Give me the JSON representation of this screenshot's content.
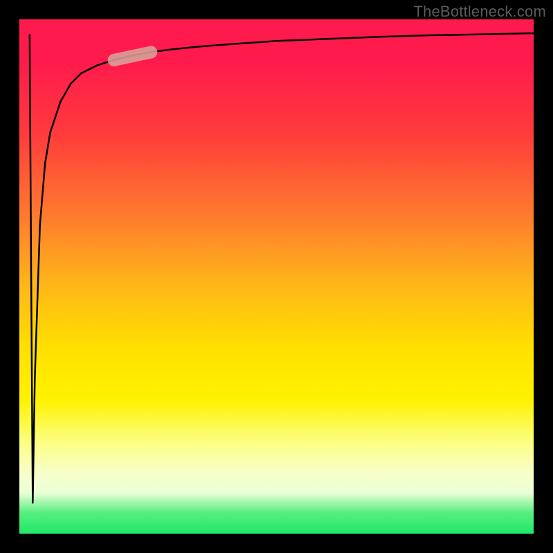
{
  "watermark": "TheBottleneck.com",
  "colors": {
    "frame": "#000000",
    "curve": "#000000",
    "highlight_fill": "#d8a89c",
    "highlight_opacity": 0.85,
    "gradient_top": "#ff1a4d",
    "gradient_bottom": "#1fe86a"
  },
  "chart_data": {
    "type": "line",
    "title": "",
    "xlabel": "",
    "ylabel": "",
    "xlim": [
      0,
      100
    ],
    "ylim": [
      0,
      100
    ],
    "grid": false,
    "legend": false,
    "series": [
      {
        "name": "black-curve",
        "x": [
          2,
          2.3,
          2.6,
          3,
          4,
          5,
          6,
          8,
          10,
          12,
          15,
          18,
          22,
          26,
          30,
          35,
          40,
          50,
          60,
          70,
          80,
          90,
          100
        ],
        "y": [
          97,
          50,
          6,
          30,
          60,
          72,
          78,
          84,
          87.5,
          89.5,
          91,
          92,
          93,
          93.7,
          94.2,
          94.7,
          95.1,
          95.8,
          96.2,
          96.6,
          96.9,
          97.1,
          97.3
        ]
      }
    ],
    "annotations": [
      {
        "name": "highlight-segment",
        "shape": "pill",
        "x_range": [
          18,
          26
        ],
        "y_range": [
          92,
          93.7
        ]
      }
    ]
  }
}
